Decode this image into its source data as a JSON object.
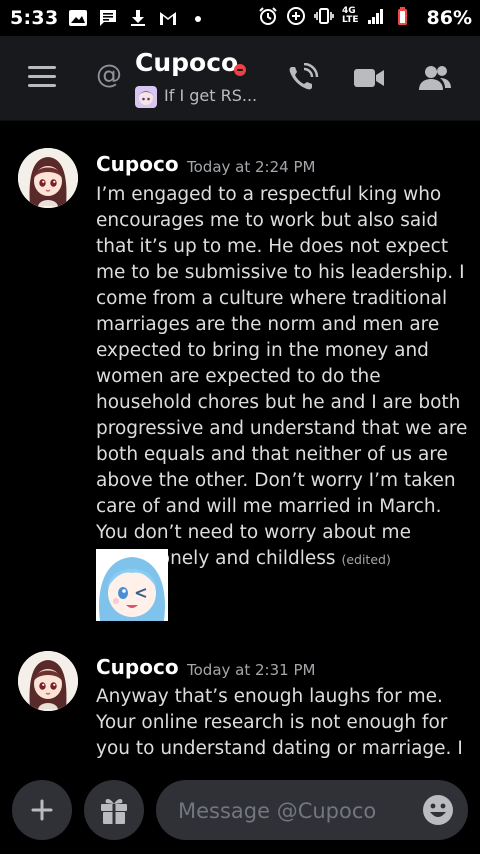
{
  "status_bar": {
    "time": "5:33",
    "network": "4G\nLTE",
    "battery": "86%"
  },
  "header": {
    "at_symbol": "@",
    "title": "Cupoco",
    "status": "dnd",
    "subtitle": "If I get RS..."
  },
  "messages": [
    {
      "author": "Cupoco",
      "timestamp": "Today at 2:24 PM",
      "text": "I’m engaged to a respectful king who encourages me to work but also said that it’s up to me. He does not expect me to be submissive to his leadership. I come from a culture where traditional marriages are the norm and men are expected to bring in the money and women are expected to do the household chores but he and I are both progressive and understand that we are both equals and that neither of us are above the other. Don’t worry I’m taken care of and will me married in March. You don’t need to worry about me being lonely and childless",
      "edited": "(edited)",
      "has_sticker": true
    },
    {
      "author": "Cupoco",
      "timestamp": "Today at 2:31 PM",
      "text": "Anyway that’s enough laughs for me. Your online research is not enough for you to understand dating or marriage. I"
    }
  ],
  "composer": {
    "placeholder": "Message @Cupoco"
  },
  "colors": {
    "background": "#000000",
    "header": "#18191c",
    "input": "#2f3136",
    "dnd": "#ed4245",
    "battery": "#f04747"
  }
}
